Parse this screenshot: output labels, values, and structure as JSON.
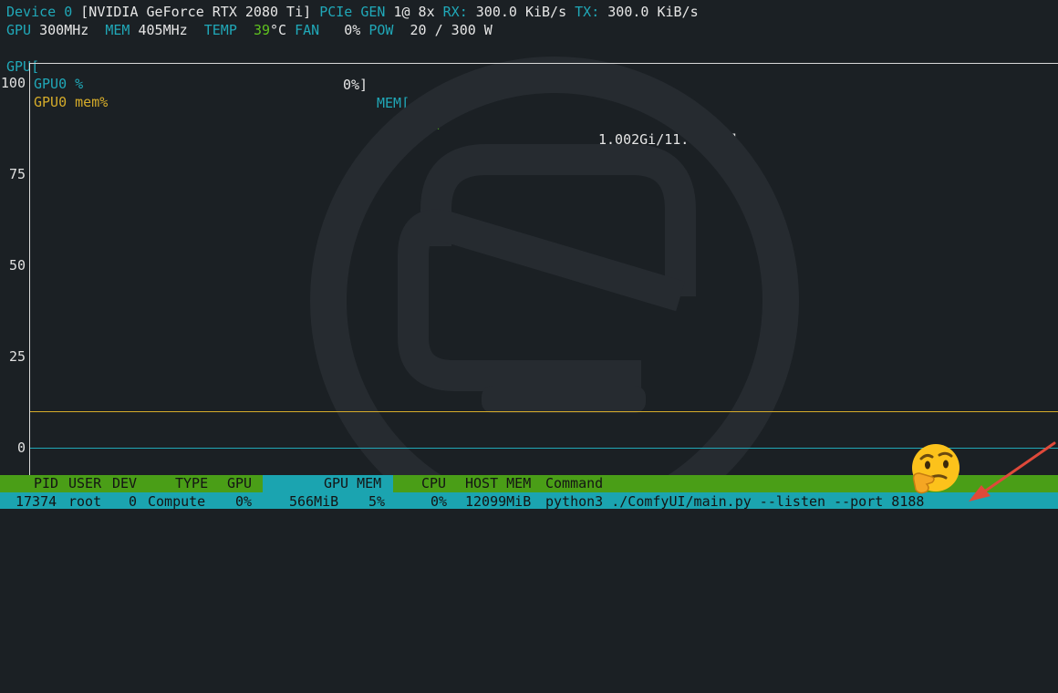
{
  "device": {
    "label": "Device 0",
    "name": "[NVIDIA GeForce RTX 2080 Ti]",
    "pcie_label": "PCIe",
    "gen_label": "GEN",
    "gen_value": "1@ 8x",
    "rx_label": "RX:",
    "rx_value": "300.0 KiB/s",
    "tx_label": "TX:",
    "tx_value": "300.0 KiB/s"
  },
  "clocks": {
    "gpu_label": "GPU",
    "gpu_value": "300MHz",
    "mem_label": "MEM",
    "mem_value": "405MHz",
    "temp_label": "TEMP",
    "temp_value": "39",
    "temp_unit": "°C",
    "fan_label": "FAN",
    "fan_value": "0%",
    "pow_label": "POW",
    "pow_value": "20 / 300 W"
  },
  "bars": {
    "gpu_label": "GPU[",
    "gpu_value": "0%]",
    "mem_label": "MEM[",
    "mem_fill": "|||",
    "mem_value": "1.002Gi/11.000Gi]",
    "gpu_util": 0,
    "mem_used_gi": 1.002,
    "mem_total_gi": 11.0
  },
  "chart_data": {
    "type": "line",
    "y_ticks": [
      "100",
      "75",
      "50",
      "25",
      "0"
    ],
    "ylim": [
      0,
      100
    ],
    "series": [
      {
        "name": "GPU0 %",
        "color": "#20a8b8",
        "values": [
          0
        ]
      },
      {
        "name": "GPU0 mem%",
        "color": "#d6ac2a",
        "values": [
          10
        ]
      }
    ]
  },
  "process_table": {
    "headers": {
      "pid": "PID",
      "user": "USER",
      "dev": "DEV",
      "type": "TYPE",
      "gpu": "GPU",
      "gpu_mem": "GPU MEM",
      "cpu": "CPU",
      "host_mem": "HOST MEM",
      "command": "Command"
    },
    "rows": [
      {
        "pid": "17374",
        "user": "root",
        "dev": "0",
        "type": "Compute",
        "gpu": "0%",
        "gpu_mem": "566MiB",
        "gpu_mem_pct": "5%",
        "cpu": "0%",
        "host_mem": "12099MiB",
        "command": "python3 ./ComfyUI/main.py --listen --port 8188"
      }
    ]
  },
  "colors": {
    "background": "#1b2024",
    "label_cyan": "#20a8b8",
    "value_white": "#e6e6e6",
    "gpu_mem_series": "#d6ac2a",
    "header_green": "#4a9e17",
    "row_cyan": "#1ba4b0",
    "arrow_red": "#e0493a"
  },
  "icons": {
    "watermark": "zh-logo-watermark",
    "emoji": "thinking-face-icon",
    "annotation": "red-arrow-icon"
  }
}
